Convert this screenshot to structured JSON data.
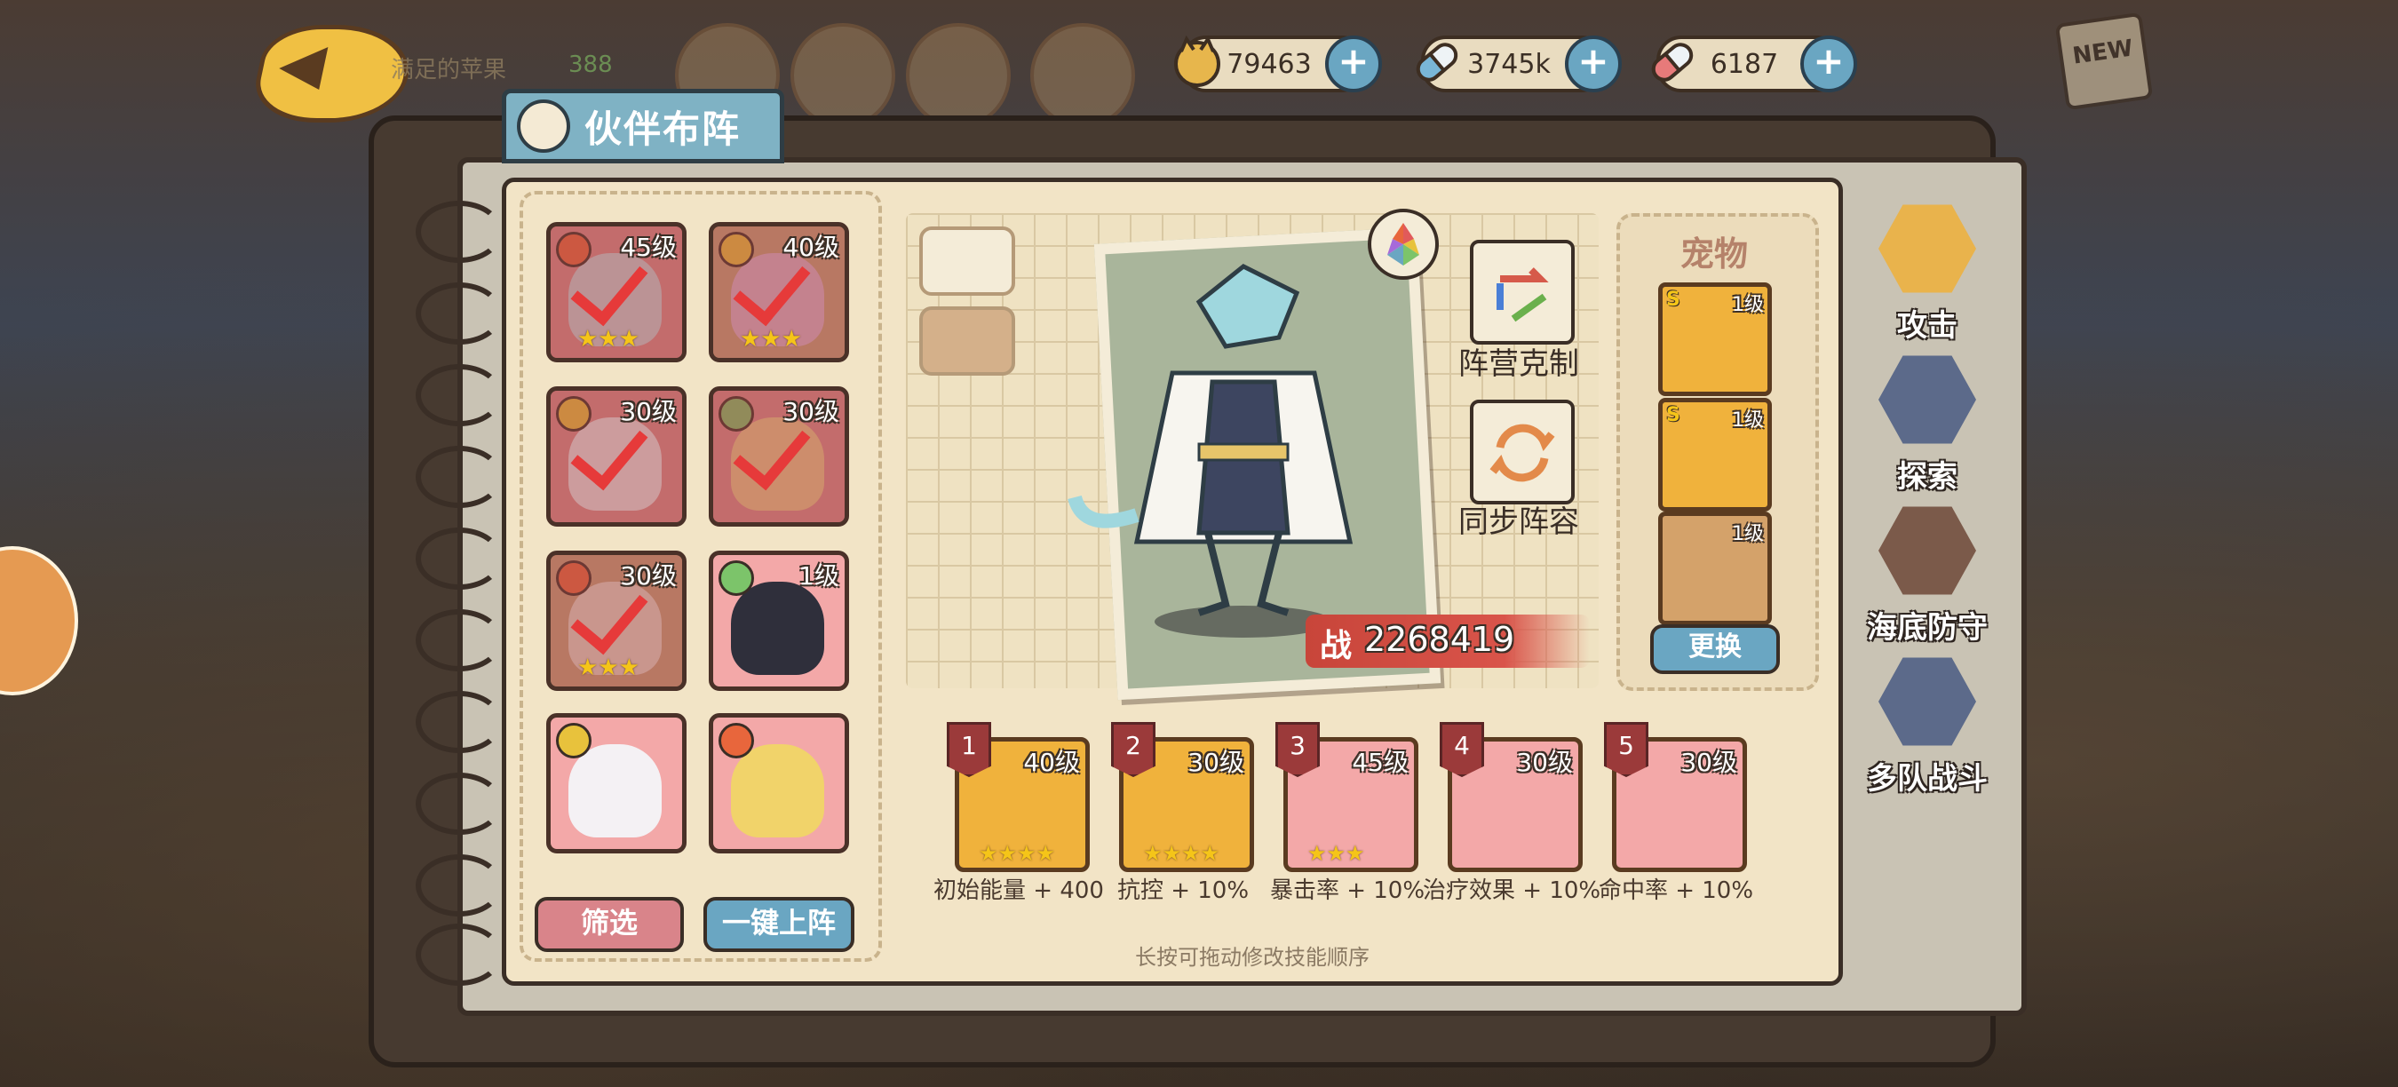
{
  "header": {
    "player_name": "满足的苹果",
    "player_extra": "388",
    "currencies": [
      {
        "name": "coin",
        "icon": "cat-coin-icon",
        "value": "79463"
      },
      {
        "name": "capsule-blue",
        "icon": "blue-capsule-icon",
        "value": "3745k"
      },
      {
        "name": "capsule-red",
        "icon": "red-capsule-icon",
        "value": "6187"
      }
    ],
    "new_badge": "NEW"
  },
  "panel": {
    "title": "伙伴布阵"
  },
  "hero_list": [
    {
      "level": "45级",
      "element": "fire",
      "selected": true,
      "stars": "★★★"
    },
    {
      "level": "40级",
      "element": "thunder",
      "selected": true,
      "stars": "★★★"
    },
    {
      "level": "30级",
      "element": "thunder",
      "selected": true,
      "stars": ""
    },
    {
      "level": "30级",
      "element": "wind",
      "selected": true,
      "stars": ""
    },
    {
      "level": "30级",
      "element": "fire",
      "selected": true,
      "stars": "★★★"
    },
    {
      "level": "1级",
      "element": "wind",
      "selected": false,
      "stars": ""
    },
    {
      "level": "",
      "element": "thunder",
      "selected": false,
      "stars": ""
    },
    {
      "level": "",
      "element": "fire",
      "selected": false,
      "stars": ""
    }
  ],
  "buttons": {
    "filter": "筛选",
    "auto_deploy": "一键上阵",
    "replace": "更换"
  },
  "center": {
    "power_label": "战",
    "power_value": "2268419",
    "faction_counter": "阵营克制",
    "sync_team": "同步阵容",
    "hint": "长按可拖动修改技能顺序"
  },
  "pets": {
    "title": "宠物",
    "items": [
      {
        "level": "1级",
        "rank": "S"
      },
      {
        "level": "1级",
        "rank": "S"
      },
      {
        "level": "1级",
        "rank": ""
      }
    ]
  },
  "skill_slots": [
    {
      "order": "1",
      "level": "40级",
      "bonus": "初始能量 + 400",
      "stars": "★★★★"
    },
    {
      "order": "2",
      "level": "30级",
      "bonus": "抗控 + 10%",
      "stars": "★★★★"
    },
    {
      "order": "3",
      "level": "45级",
      "bonus": "暴击率 + 10%",
      "stars": "★★★"
    },
    {
      "order": "4",
      "level": "30级",
      "bonus": "治疗效果 + 10%",
      "stars": ""
    },
    {
      "order": "5",
      "level": "30级",
      "bonus": "命中率 + 10%",
      "stars": ""
    }
  ],
  "right_tabs": [
    {
      "label": "攻击",
      "icon": "sword-icon",
      "active": true
    },
    {
      "label": "探索",
      "icon": "explore-icon",
      "active": false
    },
    {
      "label": "海底防守",
      "icon": "sea-defense-icon",
      "active": false
    },
    {
      "label": "多队战斗",
      "icon": "multi-team-icon",
      "active": false
    }
  ],
  "colors": {
    "accent_blue": "#7fb2c4",
    "paper": "#f2e4c6",
    "filter_btn": "#d9848a",
    "deploy_btn": "#6aa6c2",
    "power_red": "#c8453a"
  }
}
